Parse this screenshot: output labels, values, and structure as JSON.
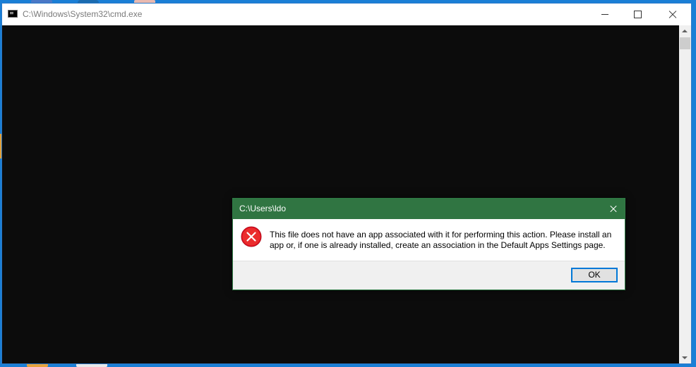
{
  "console": {
    "title": "C:\\Windows\\System32\\cmd.exe",
    "background_color": "#0c0c0c",
    "icons": {
      "app": "console-app-icon",
      "minimize": "minimize-icon",
      "maximize": "maximize-icon",
      "close": "close-icon"
    }
  },
  "dialog": {
    "title": "C:\\Users\\ldo",
    "message": "This file does not have an app associated with it for performing this action. Please install an app or, if one is already installed, create an association in the Default Apps Settings page.",
    "ok_label": "OK",
    "icon": "error-icon",
    "titlebar_color": "#307542",
    "accent_color": "#0078d7"
  }
}
